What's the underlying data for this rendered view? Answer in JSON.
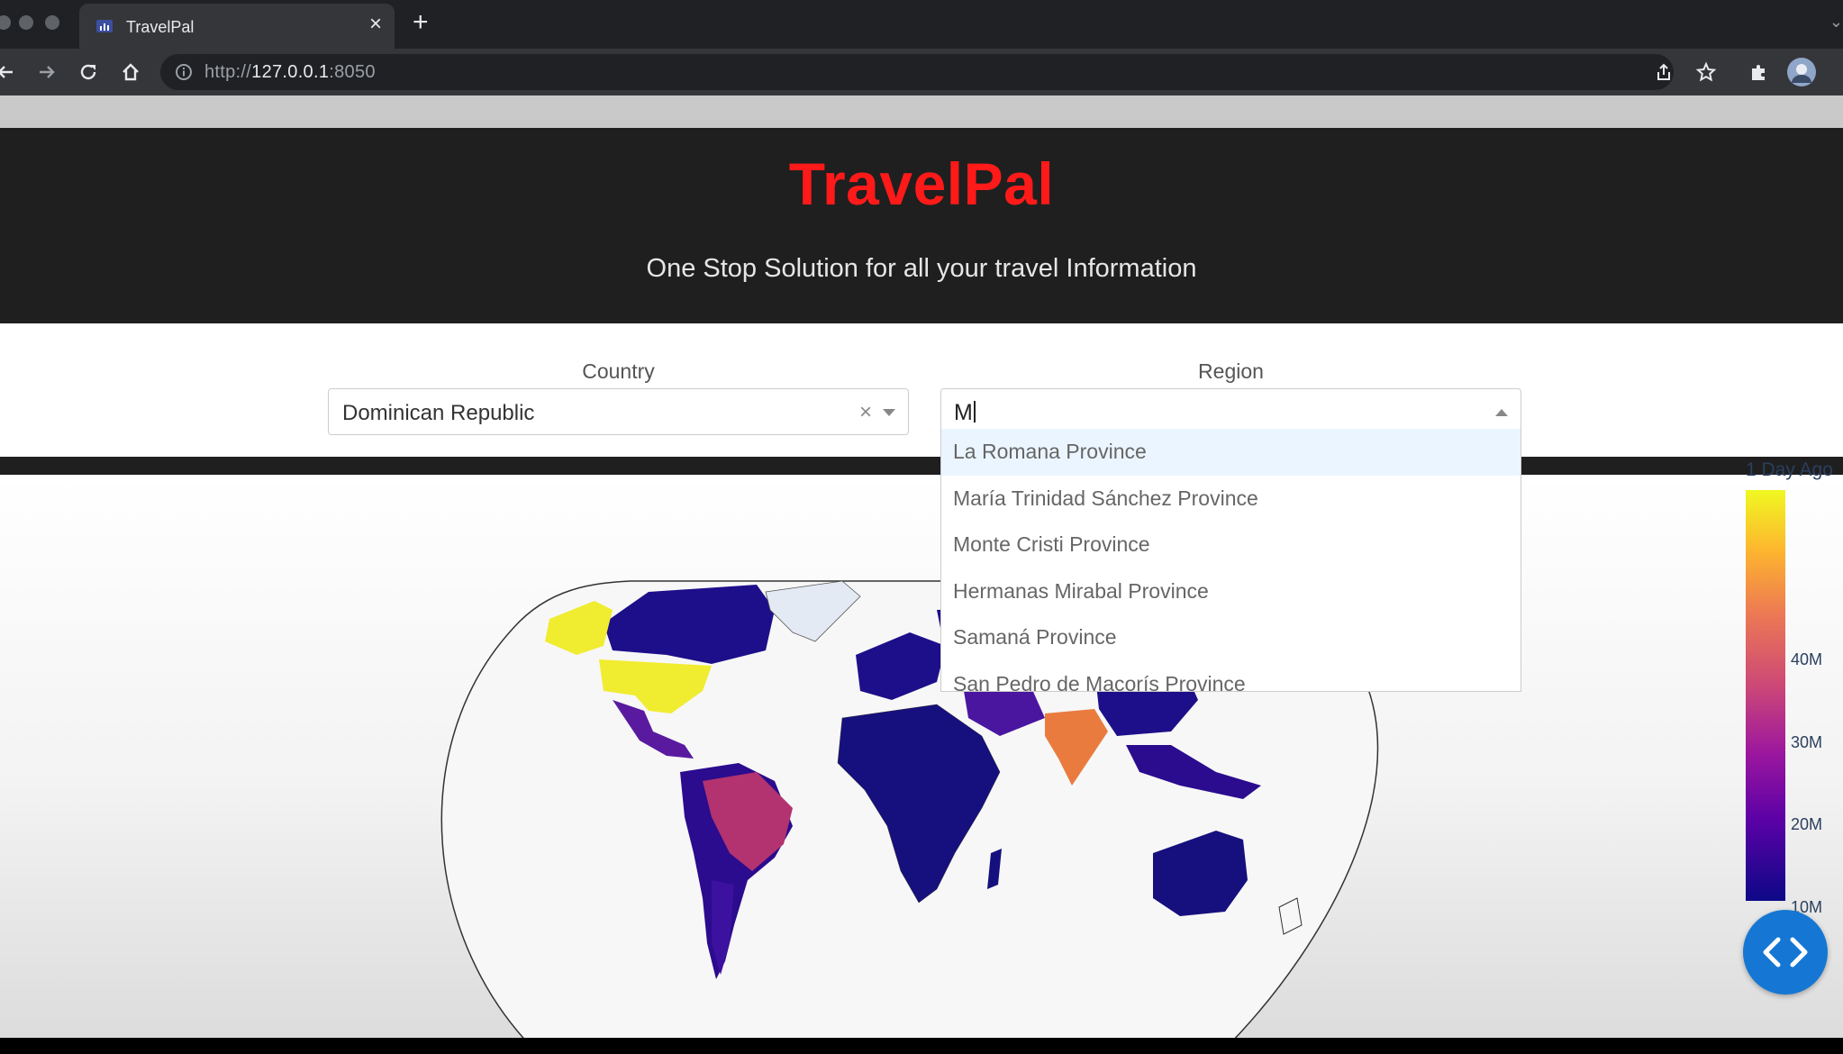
{
  "browser": {
    "tab_title": "TravelPal",
    "url_scheme": "http://",
    "url_host": "127.0.0.1",
    "url_port": ":8050",
    "new_tab_symbol": "+",
    "close_symbol": "×"
  },
  "header": {
    "title": "TravelPal",
    "subtitle": "One Stop Solution for all your travel Information",
    "title_color": "#ff1a1a"
  },
  "filters": {
    "country_label": "Country",
    "country_value": "Dominican Republic",
    "clear_symbol": "×",
    "region_label": "Region",
    "region_input": "M"
  },
  "region_options": [
    "La Romana Province",
    "María Trinidad Sánchez Province",
    "Monte Cristi Province",
    "Hermanas Mirabal Province",
    "Samaná Province",
    "San Pedro de Macorís Province"
  ],
  "map": {
    "colorbar_title": "1 Day Ago",
    "ticks": [
      "40M",
      "30M",
      "20M",
      "10M"
    ],
    "colorscale": [
      "#0d0887",
      "#5c01a6",
      "#9c179e",
      "#cc4778",
      "#ed7953",
      "#fdb42f",
      "#f0f921"
    ]
  },
  "icons": {
    "back": "arrow-left-icon",
    "forward": "arrow-right-icon",
    "reload": "reload-icon",
    "home": "home-icon",
    "info": "info-icon",
    "share": "share-icon",
    "bookmark": "star-icon",
    "extensions": "puzzle-icon",
    "profile": "avatar",
    "code": "code-icon"
  }
}
